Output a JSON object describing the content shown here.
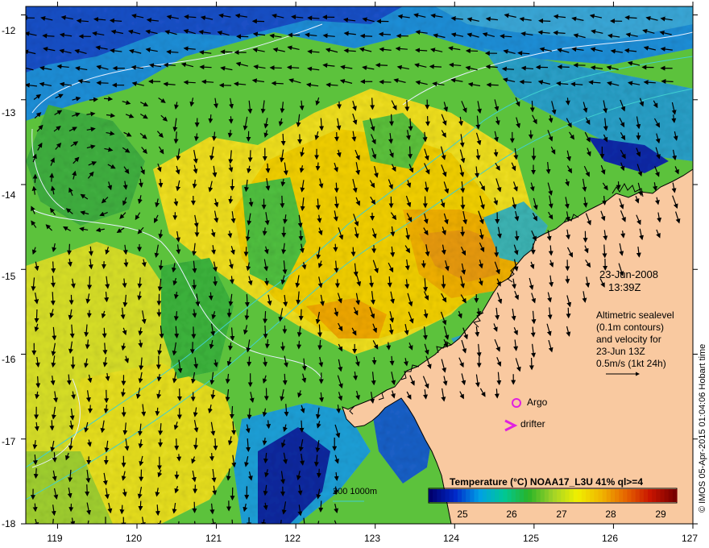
{
  "map": {
    "date": "23-Jun-2008",
    "time": "13:39Z",
    "annotation_lines": [
      "Altimetric sealevel",
      "(0.1m contours)",
      "and velocity for",
      "23-Jun 13Z",
      "0.5m/s (1kt 24h)"
    ],
    "argo_label": "Argo",
    "drifter_label": "drifter",
    "drifter_symbol": ">",
    "depth_label": "200  1000m",
    "credit": "© IMOS 05-Apr-2015 01:04:06 Hobart time",
    "lat_labels": [
      "-12",
      "-13",
      "-14",
      "-15",
      "-16",
      "-17",
      "-18"
    ],
    "lon_labels": [
      "119",
      "120",
      "121",
      "122",
      "123",
      "124",
      "125",
      "126",
      "127"
    ],
    "lon_range": [
      118.6,
      127
    ],
    "lat_range": [
      -18,
      -11.9
    ],
    "colors": {
      "land": "#f9c9a0",
      "argo": "#e020e0",
      "drifter": "#e020e0",
      "contour": "#e8f0ff",
      "isobath_200": "#40d0d0",
      "isobath_1000": "#40d0d0",
      "coast": "#000000"
    },
    "colorbar": {
      "title": "Temperature (°C) NOAA17_L3U 41% ql>=4",
      "min": 24.3,
      "max": 29.3,
      "ticks": [
        "25",
        "26",
        "27",
        "28",
        "29"
      ],
      "colors": [
        "#00006e",
        "#0028c8",
        "#00a0e6",
        "#00c896",
        "#28b428",
        "#a0d228",
        "#f0f000",
        "#f0b400",
        "#e66400",
        "#c81400",
        "#780000"
      ]
    }
  }
}
